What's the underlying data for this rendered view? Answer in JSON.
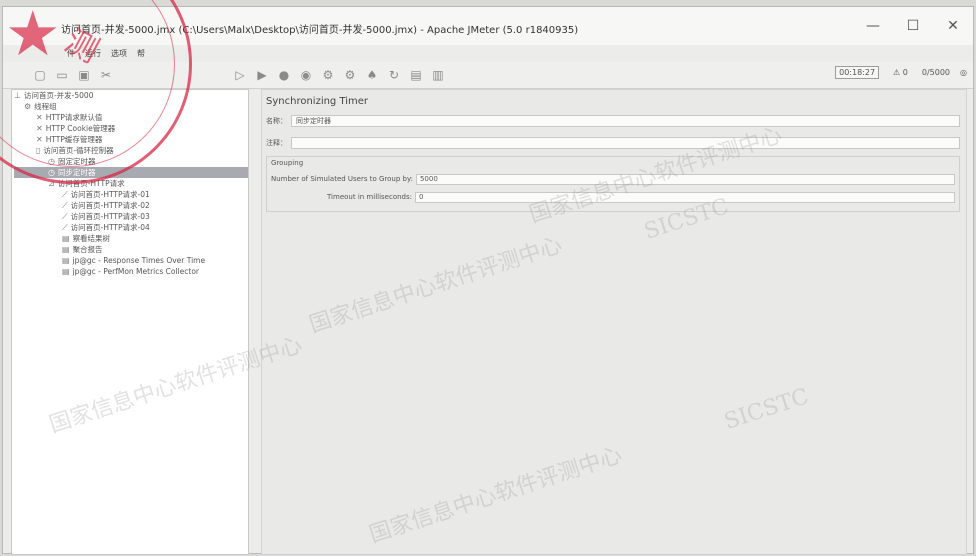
{
  "window": {
    "title": "访问首页-并发-5000.jmx (C:\\Users\\Malx\\Desktop\\访问首页-并发-5000.jmx) - Apache JMeter (5.0 r1840935)",
    "controls": {
      "minimize": "—",
      "maximize": "☐",
      "close": "✕"
    }
  },
  "menu": [
    "件",
    "运行",
    "选项",
    "帮"
  ],
  "toolbar": {
    "timer": "00:18:27",
    "warnings": "0",
    "ratio": "0/5000",
    "icons": [
      "new-icon",
      "open-icon",
      "save-icon",
      "cut-icon",
      "copy-icon",
      "paste-icon",
      "expand-icon",
      "collapse-icon",
      "toggle-icon",
      "start-icon",
      "start-no-pause-icon",
      "stop-icon",
      "shutdown-icon",
      "clear-icon",
      "clear-all-icon",
      "search-icon",
      "reset-search-icon",
      "function-helper-icon",
      "help-icon"
    ]
  },
  "tree": [
    {
      "label": "访问首页-并发-5000",
      "icon": "testplan-icon"
    },
    {
      "label": "线程组",
      "icon": "threadgroup-icon"
    },
    {
      "label": "HTTP请求默认值",
      "icon": "config-icon"
    },
    {
      "label": "HTTP Cookie管理器",
      "icon": "config-icon"
    },
    {
      "label": "HTTP缓存管理器",
      "icon": "config-icon"
    },
    {
      "label": "访问首页-循环控制器",
      "icon": "controller-icon"
    },
    {
      "label": "固定定时器",
      "icon": "timer-icon"
    },
    {
      "label": "同步定时器",
      "icon": "timer-icon"
    },
    {
      "label": "访问首页-HTTP请求",
      "icon": "sampler-icon"
    },
    {
      "label": "访问首页-HTTP请求-01",
      "icon": "sampler-icon"
    },
    {
      "label": "访问首页-HTTP请求-02",
      "icon": "sampler-icon"
    },
    {
      "label": "访问首页-HTTP请求-03",
      "icon": "sampler-icon"
    },
    {
      "label": "访问首页-HTTP请求-04",
      "icon": "sampler-icon"
    },
    {
      "label": "察看结果树",
      "icon": "listener-icon"
    },
    {
      "label": "聚合报告",
      "icon": "listener-icon"
    },
    {
      "label": "jp@gc - Response Times Over Time",
      "icon": "listener-icon"
    },
    {
      "label": "jp@gc - PerfMon Metrics Collector",
      "icon": "listener-icon"
    }
  ],
  "panel": {
    "title": "Synchronizing Timer",
    "name_label": "名称：",
    "name_value": "同步定时器",
    "comment_label": "注释：",
    "comment_value": "",
    "grouping_title": "Grouping",
    "users_label": "Number of Simulated Users to Group by:",
    "users_value": "5000",
    "timeout_label": "Timeout in milliseconds:",
    "timeout_value": "0"
  },
  "watermarks": [
    "国家信息中心软件评测中心",
    "SICSTC"
  ],
  "stamp_text": "测"
}
